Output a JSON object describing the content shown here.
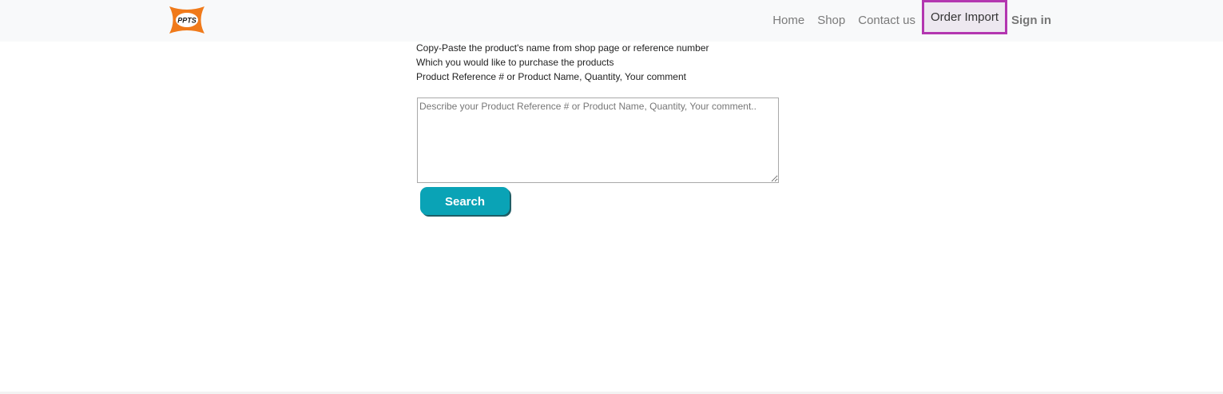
{
  "header": {
    "logo_text": "PPTS",
    "nav": [
      {
        "label": "Home"
      },
      {
        "label": "Shop"
      },
      {
        "label": "Contact us"
      },
      {
        "label": "Order Import"
      },
      {
        "label": "Sign in"
      }
    ]
  },
  "main": {
    "instructions": [
      "Copy-Paste the product's name from shop page or reference number",
      "Which you would like to purchase the products",
      "Product Reference # or Product Name, Quantity, Your comment"
    ],
    "textarea_placeholder": "Describe your Product Reference # or Product Name, Quantity, Your comment..",
    "textarea_value": "",
    "search_label": "Search"
  },
  "colors": {
    "accent": "#0aa3b6",
    "logo_orange": "#f07a1a",
    "active_border": "#b336b0"
  }
}
